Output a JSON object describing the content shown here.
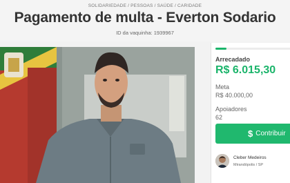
{
  "header": {
    "categories": "SOLIDARIEDADE / PESSOAS / SAÚDE / CARIDADE",
    "title": "Pagamento de multa - Everton Sodario",
    "campaign_id": "ID da vaquinha: 1939967"
  },
  "stats": {
    "raised_label": "Arrecadado",
    "raised_value": "R$ 6.015,30",
    "goal_label": "Meta",
    "goal_value": "R$ 40.000,00",
    "supporters_label": "Apoiadores",
    "supporters_value": "62",
    "progress_fraction": 0.15
  },
  "actions": {
    "contribute_label": "Contribuir",
    "contribute_icon": "dollar-icon"
  },
  "creator": {
    "name": "Cleber Medeiros",
    "location": "Mirandópolis / SP"
  },
  "colors": {
    "accent": "#20b86e",
    "raised_text": "#1ab46a"
  }
}
